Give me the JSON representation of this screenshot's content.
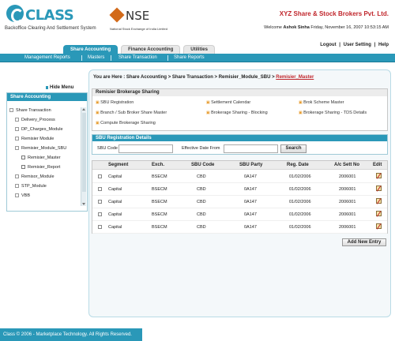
{
  "header": {
    "logo_text": "CLASS",
    "logo_sub": "Backoffice Clearing And Settlement System",
    "nse_text": "NSE",
    "nse_sub": "National Stock Exchange of India Limited",
    "company": "XYZ Share & Stock Brokers Pvt. Ltd.",
    "welcome_prefix": "Welcome",
    "welcome_user": "Ashok Sinha",
    "welcome_time": "Friday, November 16, 2007 10:53:15 AM"
  },
  "nav": {
    "tabs": [
      "Share Accounting",
      "Finance Accounting",
      "Utilities"
    ],
    "top_links": [
      "Logout",
      "User Setting",
      "Help"
    ],
    "subnav": [
      "Management Reports",
      "Masters",
      "Share Transaction",
      "Share Reports"
    ]
  },
  "left": {
    "hide_menu": "Hide Menu",
    "panel_title": "Share Accounting",
    "tree": [
      "Share Transaction",
      "Delivery_Process",
      "DP_Charges_Module",
      "Remisier Module",
      "Remisier_Module_SBU",
      "Remisier_Master",
      "Remisier_Report",
      "Remisor_Module",
      "STP_Module",
      "VBB"
    ]
  },
  "main": {
    "breadcrumb_prefix": "You are Here : Share Accounting > Share Transaction > Remisier_Module_SBU >",
    "breadcrumb_current": "Remisier_Master",
    "brokerage_title": "Remisier Brokerage Sharing",
    "brokerage_links": [
      "SBU Registration",
      "Settlement Calendar",
      "Brok Scheme Master",
      "Branch / Sub Broker Share Master",
      "Brokerage Sharing - Blocking",
      "Brokerage Sharing - TDS Details",
      "Compute Brokerage Sharing"
    ],
    "registration_title": "SBU Registration Details",
    "sbu_code_label": "SBU Code",
    "effective_label": "Effective Date From",
    "search_button": "Search",
    "table_headers": [
      "Segment",
      "Exch.",
      "SBU Code",
      "SBU Party",
      "Reg. Date",
      "A/c Sett No",
      "Edit"
    ],
    "rows": [
      [
        "Capital",
        "BSECM",
        "CBD",
        "0A147",
        "01/02/2006",
        "2006001"
      ],
      [
        "Capital",
        "BSECM",
        "CBD",
        "0A147",
        "01/02/2006",
        "2006001"
      ],
      [
        "Capital",
        "BSECM",
        "CBD",
        "0A147",
        "01/02/2006",
        "2006001"
      ],
      [
        "Capital",
        "BSECM",
        "CBD",
        "0A147",
        "01/02/2006",
        "2006001"
      ],
      [
        "Capital",
        "BSECM",
        "CBD",
        "0A147",
        "01/02/2006",
        "2006001"
      ]
    ],
    "add_button": "Add New Entry"
  },
  "footer": {
    "text": "Class © 2006 - Marketplace Technology. All Rights Reserved."
  }
}
